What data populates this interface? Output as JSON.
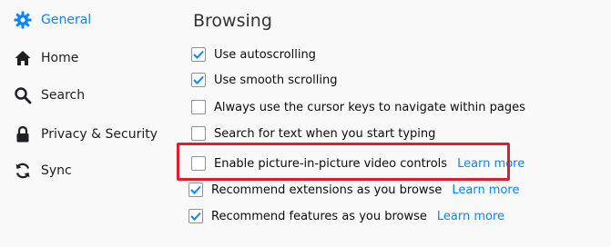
{
  "sidebar": {
    "items": [
      {
        "label": "General",
        "icon": "gear-icon",
        "active": true
      },
      {
        "label": "Home",
        "icon": "home-icon",
        "active": false
      },
      {
        "label": "Search",
        "icon": "search-icon",
        "active": false
      },
      {
        "label": "Privacy & Security",
        "icon": "lock-icon",
        "active": false
      },
      {
        "label": "Sync",
        "icon": "sync-icon",
        "active": false
      }
    ]
  },
  "main": {
    "section_title": "Browsing",
    "options": [
      {
        "label": "Use autoscrolling",
        "checked": true,
        "learn_more": ""
      },
      {
        "label": "Use smooth scrolling",
        "checked": true,
        "learn_more": ""
      },
      {
        "label": "Always use the cursor keys to navigate within pages",
        "checked": false,
        "learn_more": ""
      },
      {
        "label": "Search for text when you start typing",
        "checked": false,
        "learn_more": ""
      },
      {
        "label": "Enable picture-in-picture video controls",
        "checked": false,
        "learn_more": "Learn more"
      },
      {
        "label": "Recommend extensions as you browse",
        "checked": true,
        "learn_more": "Learn more"
      },
      {
        "label": "Recommend features as you browse",
        "checked": true,
        "learn_more": "Learn more"
      }
    ]
  },
  "colors": {
    "accent": "#0a84ff",
    "highlight": "#e01d2d"
  }
}
